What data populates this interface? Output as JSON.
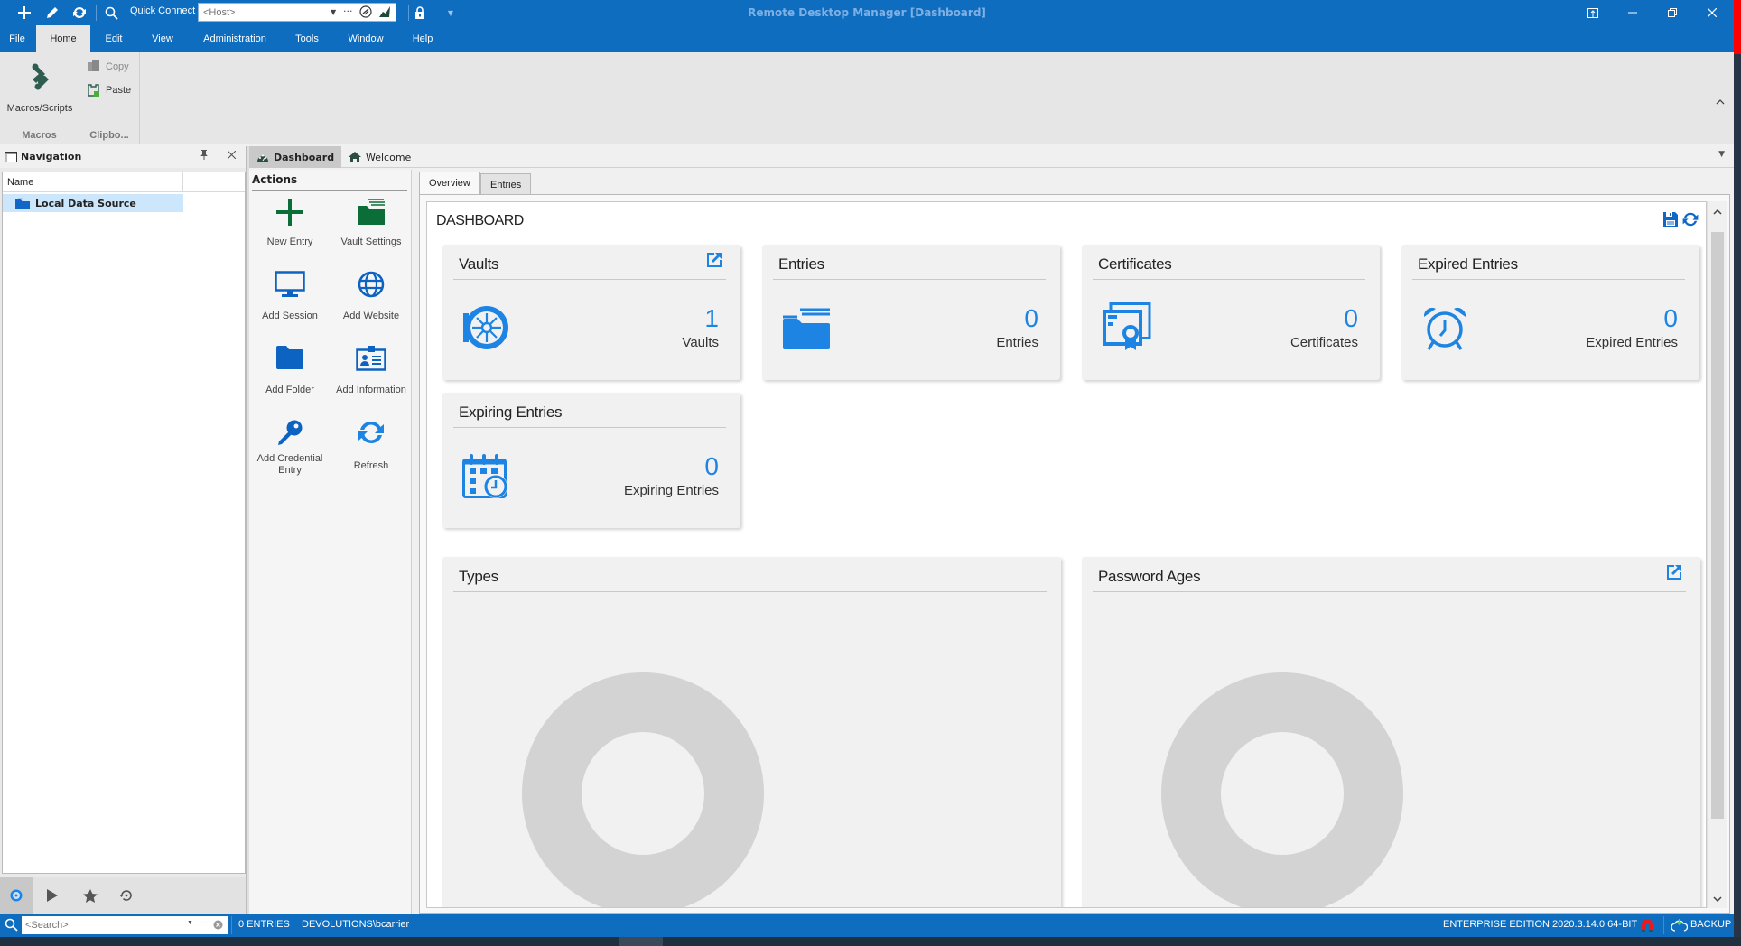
{
  "window": {
    "title": "Remote Desktop Manager [Dashboard]",
    "controls": {
      "restore_ui_icon": "layout-icon",
      "minimize": "minimize-icon",
      "maximize": "restore-icon",
      "close": "close-icon"
    }
  },
  "quick_access": {
    "buttons": [
      "add-icon",
      "edit-icon",
      "refresh-icon",
      "search-icon"
    ],
    "quick_connect_label": "Quick Connect",
    "host_placeholder": "<Host>",
    "host_value": "",
    "more_label": "···",
    "lock_icon": "lock-icon"
  },
  "menu": {
    "items": [
      "File",
      "Home",
      "Edit",
      "View",
      "Administration",
      "Tools",
      "Window",
      "Help"
    ],
    "active": "Home"
  },
  "ribbon": {
    "groups": [
      {
        "label": "Macros",
        "buttons": [
          {
            "label": "Macros/Scripts",
            "icon": "script-icon"
          }
        ]
      },
      {
        "label": "Clipbo...",
        "buttons": [
          {
            "label": "Copy",
            "icon": "copy-icon",
            "enabled": false
          },
          {
            "label": "Paste",
            "icon": "paste-icon",
            "enabled": true
          }
        ]
      }
    ]
  },
  "navigation": {
    "title": "Navigation",
    "column_header": "Name",
    "items": [
      {
        "label": "Local Data Source",
        "selected": true
      }
    ],
    "bottom_tabs": [
      "vault-icon",
      "play-icon",
      "star-icon",
      "history-icon"
    ]
  },
  "doc_tabs": [
    {
      "label": "Dashboard",
      "icon": "dashboard-icon",
      "active": true
    },
    {
      "label": "Welcome",
      "icon": "home-icon",
      "active": false
    }
  ],
  "actions": {
    "title": "Actions",
    "items": [
      {
        "label": "New Entry",
        "icon": "plus-icon"
      },
      {
        "label": "Vault Settings",
        "icon": "vault-folder-icon"
      },
      {
        "label": "Add Session",
        "icon": "monitor-icon"
      },
      {
        "label": "Add Website",
        "icon": "globe-icon"
      },
      {
        "label": "Add Folder",
        "icon": "folder-icon"
      },
      {
        "label": "Add Information",
        "icon": "id-card-icon"
      },
      {
        "label": "Add Credential Entry",
        "icon": "key-icon"
      },
      {
        "label": "Refresh",
        "icon": "refresh-icon"
      }
    ]
  },
  "inner_tabs": [
    {
      "label": "Overview",
      "active": true
    },
    {
      "label": "Entries",
      "active": false
    }
  ],
  "dashboard": {
    "title": "DASHBOARD",
    "cards": [
      {
        "title": "Vaults",
        "value": "1",
        "unit": "Vaults",
        "icon": "vault-icon",
        "has_link": true
      },
      {
        "title": "Entries",
        "value": "0",
        "unit": "Entries",
        "icon": "folders-icon",
        "has_link": false
      },
      {
        "title": "Certificates",
        "value": "0",
        "unit": "Certificates",
        "icon": "certificate-icon",
        "has_link": false
      },
      {
        "title": "Expired Entries",
        "value": "0",
        "unit": "Expired Entries",
        "icon": "alarm-clock-icon",
        "has_link": false
      },
      {
        "title": "Expiring Entries",
        "value": "0",
        "unit": "Expiring Entries",
        "icon": "calendar-clock-icon",
        "has_link": false
      }
    ],
    "charts": [
      {
        "title": "Types",
        "has_link": false
      },
      {
        "title": "Password Ages",
        "has_link": true
      }
    ]
  },
  "chart_data": [
    {
      "type": "pie",
      "title": "Types",
      "categories": [],
      "values": [],
      "note": "empty donut placeholder"
    },
    {
      "type": "pie",
      "title": "Password Ages",
      "categories": [],
      "values": [],
      "note": "empty donut placeholder"
    }
  ],
  "statusbar": {
    "search_placeholder": "<Search>",
    "entries_count": "0 ENTRIES",
    "user": "DEVOLUTIONS\\bcarrier",
    "edition": "ENTERPRISE EDITION 2020.3.14.0 64-BIT",
    "backup_label": "BACKUP"
  },
  "colors": {
    "brand_blue": "#0f6dbf",
    "accent_blue": "#1e84e4",
    "action_green": "#0b6e38",
    "action_blue": "#0d63c1",
    "donut_gray": "#d3d3d3"
  }
}
